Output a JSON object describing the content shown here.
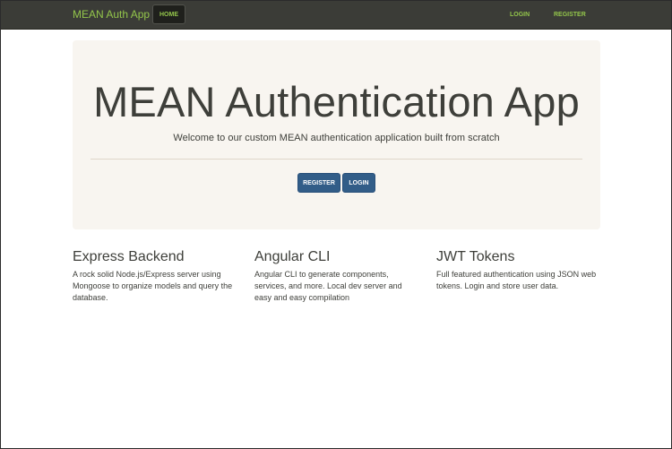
{
  "navbar": {
    "brand": "MEAN Auth App",
    "home_label": "HOME",
    "login_label": "LOGIN",
    "register_label": "REGISTER",
    "accent_color": "#93c54b",
    "background_color": "#3b3c37"
  },
  "jumbotron": {
    "title": "MEAN Authentication App",
    "lead": "Welcome to our custom MEAN authentication application built from scratch",
    "register_button": "REGISTER",
    "login_button": "LOGIN",
    "button_color": "#325d88",
    "background_color": "#f8f5f0"
  },
  "features": [
    {
      "heading": "Express Backend",
      "text": "A rock solid Node.js/Express server using Mongoose to organize models and query the database."
    },
    {
      "heading": "Angular CLI",
      "text": "Angular CLI to generate components, services, and more. Local dev server and easy and easy compilation"
    },
    {
      "heading": "JWT Tokens",
      "text": "Full featured authentication using JSON web tokens. Login and store user data."
    }
  ]
}
